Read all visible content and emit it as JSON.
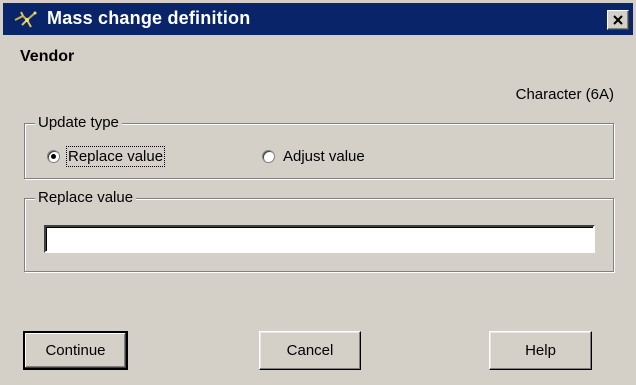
{
  "window": {
    "title": "Mass change definition",
    "close_symbol": "×",
    "icon": "app-icon"
  },
  "field": {
    "name": "Vendor",
    "type": "Character (6A)"
  },
  "update_type": {
    "legend": "Update type",
    "options": [
      {
        "label": "Replace value",
        "selected": true
      },
      {
        "label": "Adjust value",
        "selected": false
      }
    ]
  },
  "replace_value": {
    "legend": "Replace value",
    "value": "",
    "placeholder": ""
  },
  "buttons": {
    "continue_label": "Continue",
    "cancel_label": "Cancel",
    "help_label": "Help"
  },
  "colors": {
    "titlebar": "#0a246a",
    "face": "#d4d0c8"
  }
}
